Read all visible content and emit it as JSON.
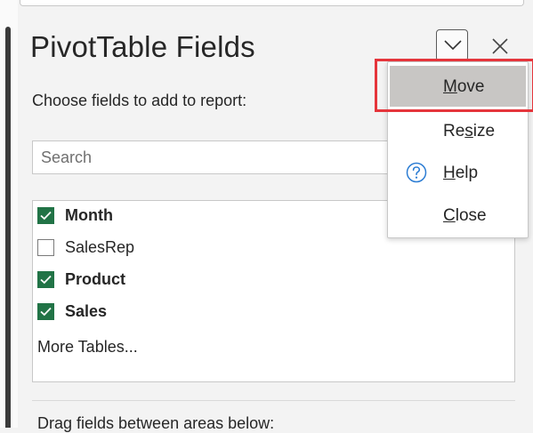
{
  "pane": {
    "title": "PivotTable Fields",
    "subtitle": "Choose fields to add to report:",
    "search_placeholder": "Search",
    "more_tables": "More Tables...",
    "drag_hint": "Drag fields between areas below:"
  },
  "fields": [
    {
      "label": "Month",
      "checked": true
    },
    {
      "label": "SalesRep",
      "checked": false
    },
    {
      "label": "Product",
      "checked": true
    },
    {
      "label": "Sales",
      "checked": true
    }
  ],
  "menu": {
    "move": "Move",
    "resize": "Resize",
    "help": "Help",
    "close": "Close"
  },
  "icons": {
    "dropdown": "chevron-down-icon",
    "close": "close-icon",
    "help": "question-circle-icon",
    "check": "checkmark-icon"
  },
  "colors": {
    "checkbox_green": "#217346",
    "highlight_red": "#e5353b",
    "help_blue": "#2b7cd3",
    "selected_item": "#c8c6c4"
  }
}
